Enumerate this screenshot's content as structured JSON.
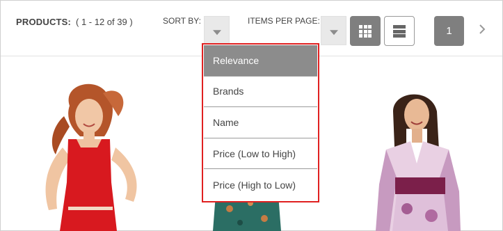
{
  "toolbar": {
    "products_label": "PRODUCTS:",
    "products_range": "(  1 - 12 of 39  )",
    "sort_label": "SORT BY:",
    "items_per_page_label": "ITEMS PER PAGE:",
    "view_grid_icon": "grid-view-icon",
    "view_list_icon": "list-view-icon",
    "current_page": "1",
    "next_icon": "chevron-right-icon"
  },
  "sort_dropdown": {
    "selected": "Relevance",
    "options": [
      "Relevance",
      "Brands",
      "Name",
      "Price (Low to High)",
      "Price (High to Low)"
    ]
  },
  "products": [
    {
      "image": "woman-in-red-dress"
    },
    {
      "image": "woman-in-green-patterned-dress"
    },
    {
      "image": "woman-in-purple-floral-dress"
    }
  ],
  "colors": {
    "dropdown_border": "#e02020",
    "selected_bg": "#8c8c8c",
    "button_dark": "#7f7f7f"
  }
}
